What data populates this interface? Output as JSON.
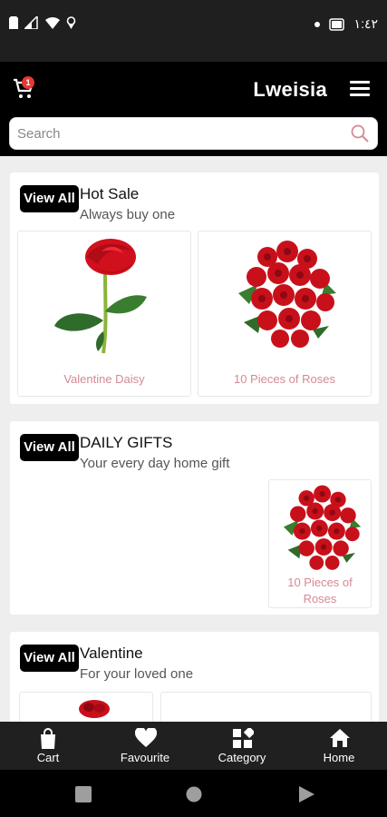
{
  "status_bar": {
    "time": "١:٤٢"
  },
  "app_bar": {
    "cart_count": "1",
    "title": "Lweisia"
  },
  "search": {
    "placeholder": "Search"
  },
  "sections": [
    {
      "view_all": "View All",
      "title": "Hot Sale",
      "subtitle": "Always buy one",
      "products": [
        {
          "name": "Valentine Daisy",
          "image": "single-red-rose"
        },
        {
          "name": "10 Pieces of Roses",
          "image": "rose-bouquet"
        }
      ]
    },
    {
      "view_all": "View All",
      "title": "DAILY GIFTS",
      "subtitle": "Your every day home gift",
      "products": [
        {
          "name": "10 Pieces of Roses",
          "image": "rose-bouquet"
        }
      ]
    },
    {
      "view_all": "View All",
      "title": "Valentine",
      "subtitle": "For your loved one",
      "products": [
        {
          "name": "",
          "image": "rose-bouquet"
        },
        {
          "name": "",
          "image": ""
        }
      ]
    }
  ],
  "bottom_nav": [
    {
      "label": "Cart",
      "icon": "shopping-bag-icon"
    },
    {
      "label": "Favourite",
      "icon": "heart-icon"
    },
    {
      "label": "Category",
      "icon": "category-icon"
    },
    {
      "label": "Home",
      "icon": "home-icon"
    }
  ],
  "colors": {
    "app_bar": "#000000",
    "badge": "#e53935",
    "product_name": "#d48a93",
    "search_icon": "#d48a93",
    "bottom_nav": "#202020"
  }
}
